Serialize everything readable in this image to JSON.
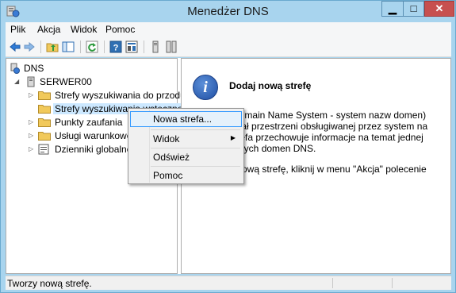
{
  "window": {
    "title": "Menedżer DNS"
  },
  "menubar": {
    "items": [
      "Plik",
      "Akcja",
      "Widok",
      "Pomoc"
    ]
  },
  "toolbar": {
    "buttons": [
      "back-arrow-icon",
      "forward-arrow-icon",
      "up-folder-icon",
      "show-hide-tree-icon",
      "refresh-icon",
      "help-icon",
      "properties-icon",
      "server-icon",
      "server-list-icon"
    ]
  },
  "tree": {
    "items": [
      {
        "label": "DNS",
        "icon": "dns-icon"
      },
      {
        "label": "SERWER00",
        "icon": "server-icon"
      },
      {
        "label": "Strefy wyszukiwania do przodu",
        "icon": "folder-icon"
      },
      {
        "label": "Strefy wyszukiwania wstecznego",
        "icon": "folder-icon"
      },
      {
        "label": "Punkty zaufania",
        "icon": "folder-icon"
      },
      {
        "label": "Usługi warunkowego",
        "icon": "folder-icon"
      },
      {
        "label": "Dzienniki globalne",
        "icon": "log-icon"
      }
    ]
  },
  "detail": {
    "title": "Dodaj nową strefę",
    "lines": [
      "(Domain Name System - system nazw domen)",
      "dział przestrzeni obsługiwanej przez system na",
      "strefa przechowuje informacje na temat jednej",
      "ległych domen DNS.",
      "ć nową strefę, kliknij w menu \"Akcja\" polecenie",
      "\"."
    ]
  },
  "context_menu": {
    "items": [
      "Nowa strefa...",
      "Widok",
      "Odśwież",
      "Pomoc"
    ]
  },
  "statusbar": {
    "text": "Tworzy nową strefę."
  },
  "colors": {
    "frame": "#a8d4ee",
    "close_button": "#c7504f",
    "selection": "#cce8ff",
    "menu_highlight": "#e5f1fb",
    "menu_highlight_border": "#3399ff",
    "info_icon": "#1f4ea3",
    "folder": "#f1c95b"
  }
}
